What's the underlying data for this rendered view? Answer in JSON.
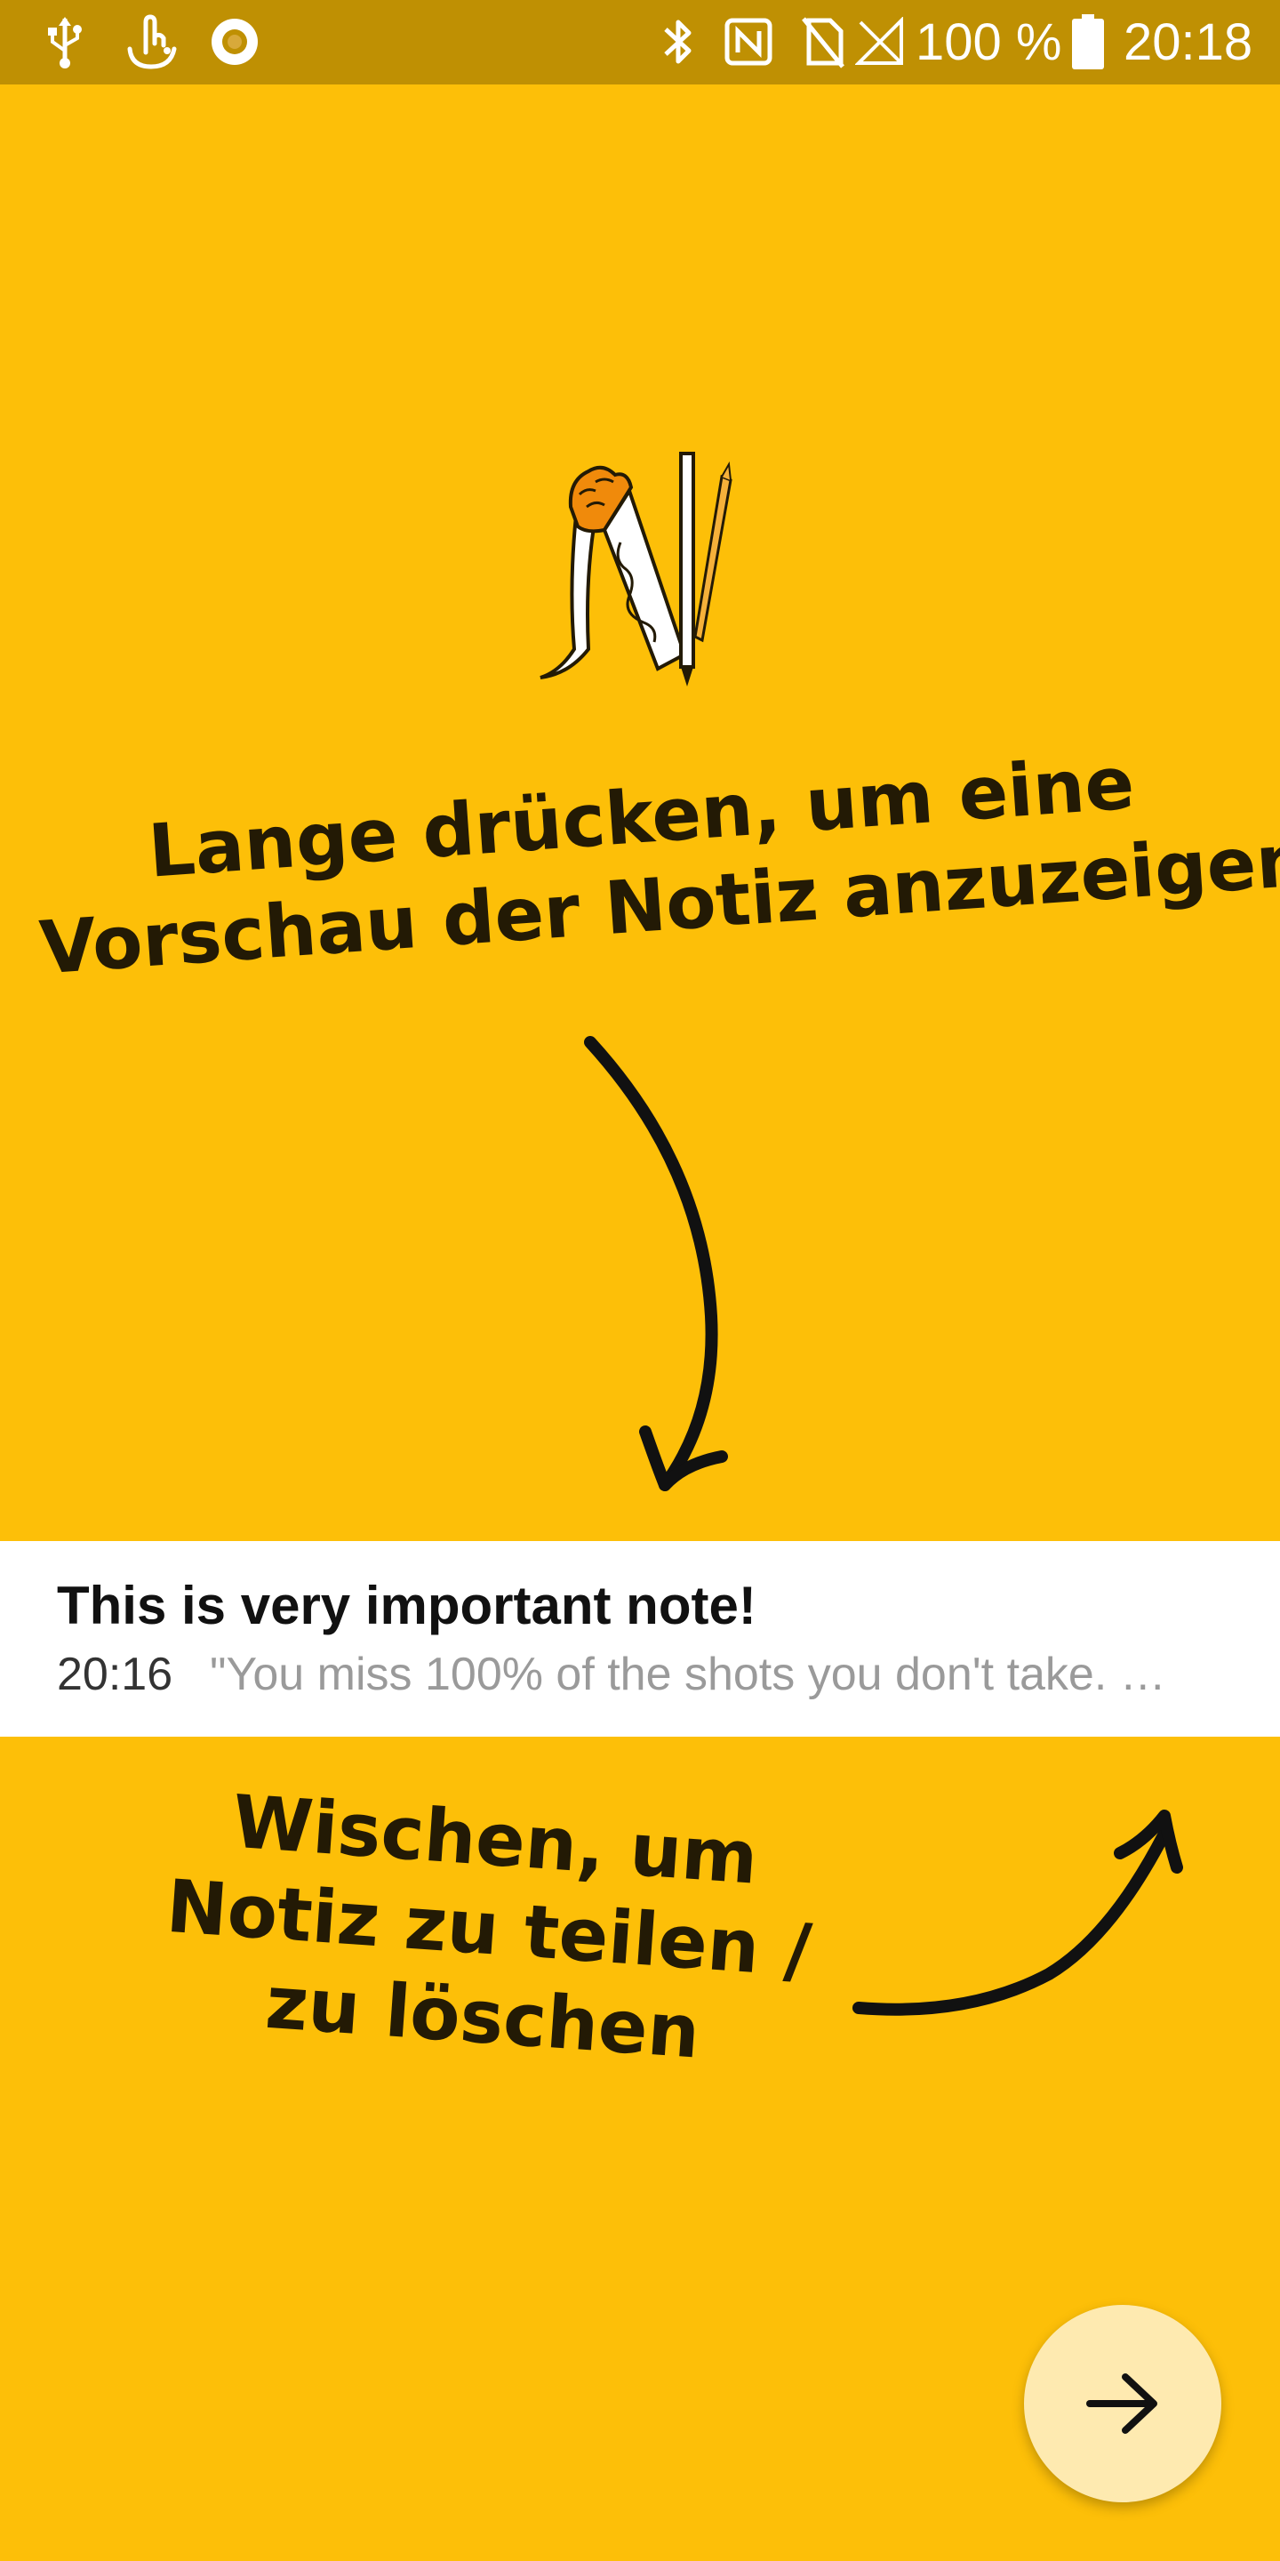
{
  "status_bar": {
    "battery_percent": "100 %",
    "time": "20:18",
    "icons_left": [
      "usb-icon",
      "touch-gesture-icon",
      "record-icon"
    ],
    "icons_right": [
      "bluetooth-icon",
      "nfc-icon",
      "no-sim-icon",
      "no-signal-icon",
      "battery-icon"
    ]
  },
  "onboarding": {
    "long_press_hint": "Lange drücken, um eine Vorschau der Notiz anzuzeigen",
    "long_press_line1": "Lange drücken, um eine",
    "long_press_line2": "Vorschau der Notiz anzuzeigen",
    "swipe_line1": "Wischen, um",
    "swipe_line2": "Notiz zu teilen /",
    "swipe_line3": "zu löschen"
  },
  "note": {
    "title": "This is very important note!",
    "time": "20:16",
    "preview": "\"You miss 100% of the shots you don't take. …"
  },
  "fab": {
    "icon": "arrow-right-icon"
  },
  "colors": {
    "background": "#FDBF08",
    "status_bar": "#BF9003",
    "fab": "#FEEAB0",
    "text_dark": "#231a05"
  }
}
